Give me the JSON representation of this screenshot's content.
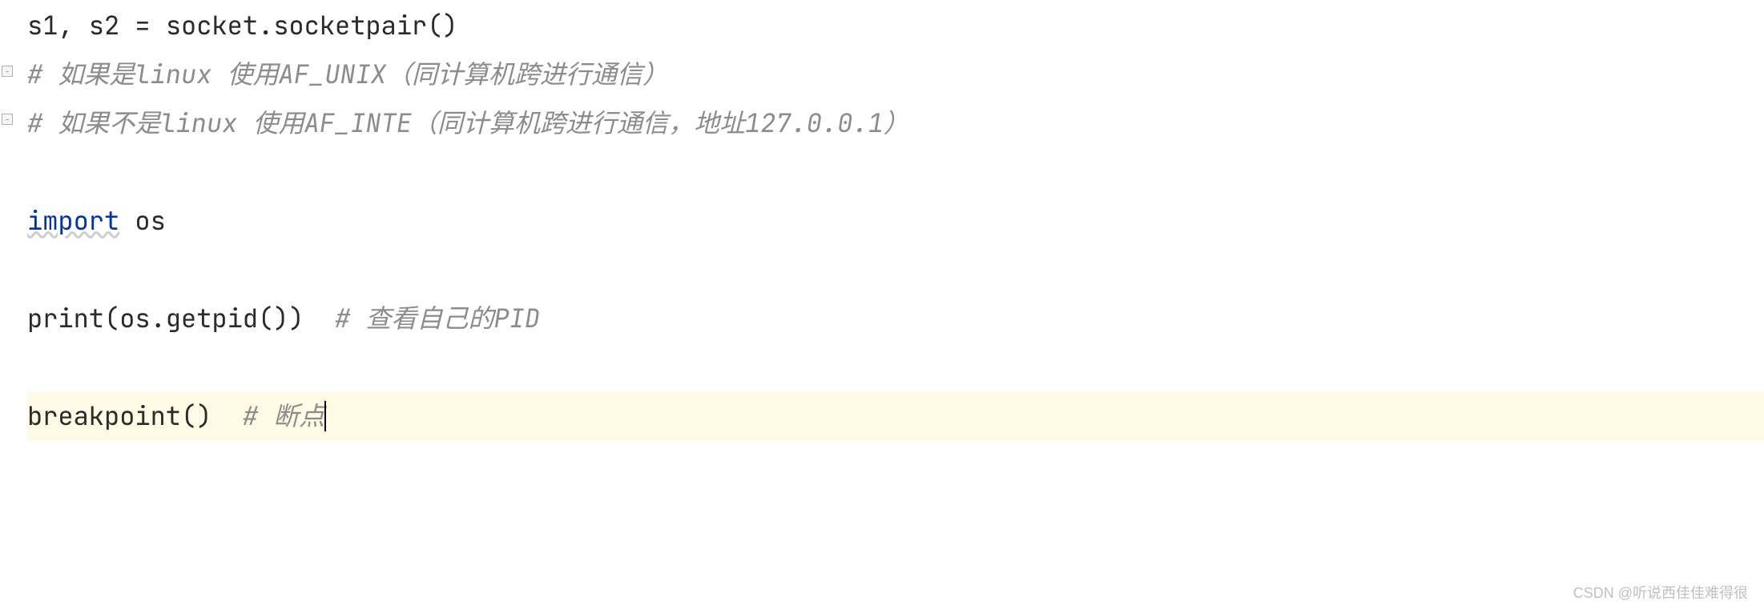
{
  "lines": {
    "l1": {
      "var": "s1, s2 = ",
      "call": "socket.socketpair()"
    },
    "l2": {
      "comment": "# 如果是linux 使用AF_UNIX（同计算机跨进行通信）"
    },
    "l3": {
      "comment": "# 如果不是linux 使用AF_INTE（同计算机跨进行通信，地址127.0.0.1）"
    },
    "l4": "",
    "l5": {
      "keyword": "import",
      "module": " os"
    },
    "l6": "",
    "l7": {
      "func": "print",
      "call": "(os.getpid())  ",
      "comment": "# 查看自己的PID"
    },
    "l8": "",
    "l9": {
      "func": "breakpoint",
      "call": "()  ",
      "comment": "# 断点"
    }
  },
  "watermark": "CSDN @听说西佳佳难得很"
}
